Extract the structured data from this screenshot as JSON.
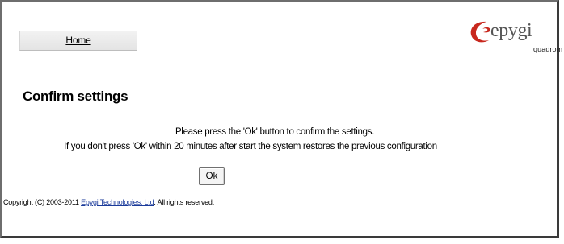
{
  "nav": {
    "home_label": "Home"
  },
  "logo": {
    "word": "epygi",
    "sub": "quadrom",
    "brand_color": "#c8281e"
  },
  "main": {
    "title": "Confirm settings",
    "line1": "Please press the 'Ok' button to confirm the settings.",
    "line2": "If you don't press 'Ok' within 20 minutes after start the system restores the previous configuration",
    "ok_label": "Ok"
  },
  "footer": {
    "prefix": "Copyright (C) 2003-2011 ",
    "link": "Epygi Technologies, Ltd",
    "suffix": ". All rights reserved."
  }
}
